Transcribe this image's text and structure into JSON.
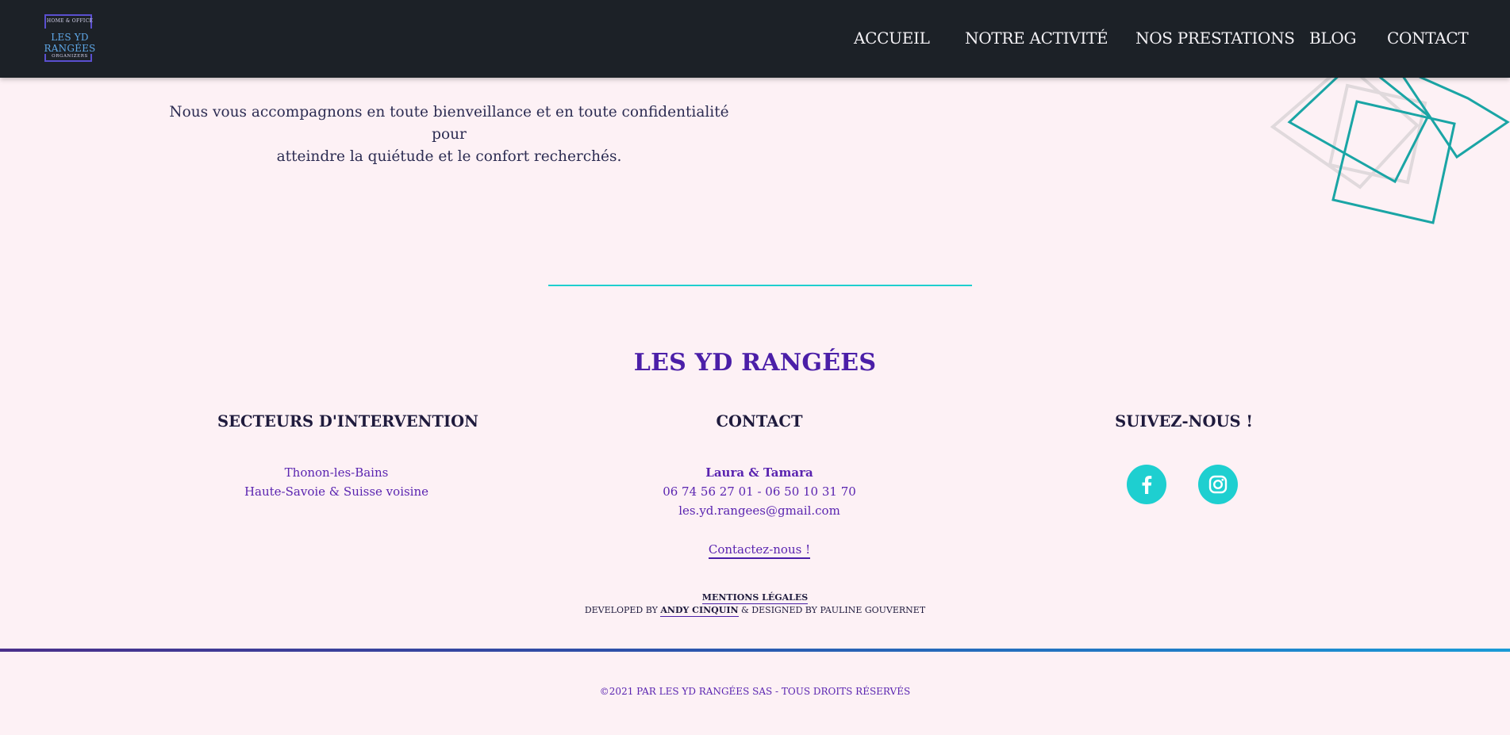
{
  "header": {
    "logo": {
      "top_text": "HOME & OFFICE",
      "main_text": "LES YD RANGÉES",
      "bottom_text": "ORGANIZERS"
    },
    "nav": [
      {
        "label": "ACCUEIL"
      },
      {
        "label": "NOTRE ACTIVITÉ"
      },
      {
        "label": "NOS PRESTATIONS"
      },
      {
        "label": "BLOG"
      },
      {
        "label": "CONTACT"
      }
    ]
  },
  "intro": {
    "line1": "Nous vous accompagnons en toute bienveillance et en toute confidentialité pour",
    "line2": "atteindre la quiétude et le confort recherchés."
  },
  "footer": {
    "brand": "LES YD RANGÉES",
    "sectors": {
      "title": "SECTEURS D'INTERVENTION",
      "line1": "Thonon-les-Bains",
      "line2": "Haute-Savoie & Suisse voisine"
    },
    "contact": {
      "title": "CONTACT",
      "names": "Laura & Tamara",
      "phones": "06 74 56 27 01  -  06 50 10 31 70",
      "email": "les.yd.rangees@gmail.com",
      "cta": "Contactez-nous !"
    },
    "social": {
      "title": "SUIVEZ-NOUS !",
      "facebook_icon": "facebook-icon",
      "instagram_icon": "instagram-icon"
    },
    "legal": "MENTIONS LÉGALES",
    "credits": {
      "developed_prefix": "DEVELOPED BY",
      "developer": "ANDY CINQUIN",
      "designed": "& DESIGNED BY PAULINE GOUVERNET"
    },
    "copyright": "©2021 PAR LES YD RANGÉES SAS - TOUS DROITS RÉSERVÉS"
  },
  "colors": {
    "header_bg": "#1c2127",
    "page_bg": "#fdf1f5",
    "accent_teal": "#1ecfd0",
    "brand_purple": "#4b1fa8"
  }
}
